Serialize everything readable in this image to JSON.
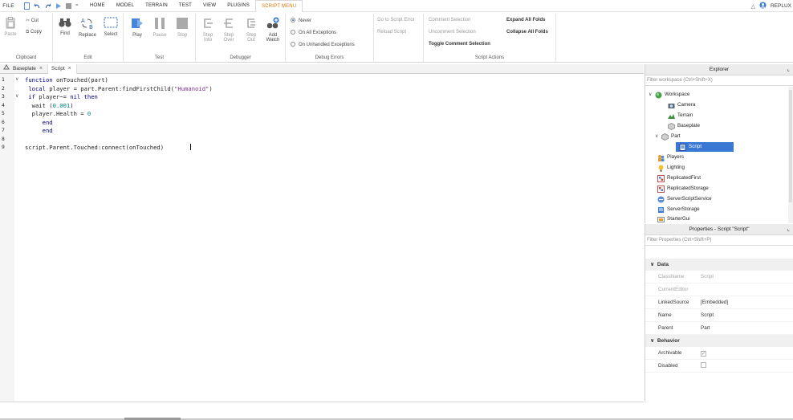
{
  "menubar": {
    "file": "FILE",
    "tabs": [
      "HOME",
      "MODEL",
      "TERRAIN",
      "TEST",
      "VIEW",
      "PLUGINS",
      "SCRIPT MENU"
    ],
    "active_tab": "SCRIPT MENU",
    "user": "REPLUX",
    "accent": "#d4730b"
  },
  "ribbon": {
    "clipboard": {
      "label": "Clipboard",
      "paste": "Paste",
      "cut": "Cut",
      "copy": "Copy"
    },
    "edit": {
      "label": "Edit",
      "find": "Find",
      "replace": "Replace",
      "select": "Select"
    },
    "test": {
      "label": "Test",
      "play": "Play",
      "pause": "Pause",
      "stop": "Stop"
    },
    "debugger": {
      "label": "Debugger",
      "step_into": "Step Into",
      "step_over": "Step Over",
      "step_out": "Step Out",
      "add_watch": "Add Watch"
    },
    "debug_errors": {
      "label": "Debug Errors",
      "never": "Never",
      "all": "On All Exceptions",
      "unhandled": "On Unhandled Exceptions",
      "selected": "Never"
    },
    "misc": {
      "goto_error": "Go to Script Error",
      "reload": "Reload Script"
    },
    "script_actions": {
      "label": "Script Actions",
      "comment": "Comment Selection",
      "uncomment": "Uncomment Selection",
      "toggle": "Toggle Comment Selection",
      "expand": "Expand All Folds",
      "collapse": "Collapse All Folds"
    }
  },
  "tabs": [
    {
      "label": "Baseplate"
    },
    {
      "label": "Script"
    }
  ],
  "editor": {
    "line_numbers": [
      "1",
      "2",
      "3",
      "4",
      "5",
      "6",
      "7",
      "8",
      "9"
    ],
    "lines": [
      "function onTouched(part)",
      " local player = part.Parent:findFirstChild(\"Humanoid\")",
      " if player~= nil then",
      "  wait (0.001)",
      "  player.Health = 0",
      "     end",
      "     end",
      "",
      "script.Parent.Touched:connect(onTouched)"
    ]
  },
  "explorer": {
    "title": "Explorer",
    "filter_placeholder": "Filter workspace (Ctrl+Shift+X)",
    "items": [
      {
        "label": "Workspace",
        "icon": "workspace-icon"
      },
      {
        "label": "Camera",
        "icon": "camera-icon"
      },
      {
        "label": "Terrain",
        "icon": "terrain-icon"
      },
      {
        "label": "Baseplate",
        "icon": "part-icon"
      },
      {
        "label": "Part",
        "icon": "part-icon"
      },
      {
        "label": "Script",
        "icon": "script-icon"
      },
      {
        "label": "Players",
        "icon": "players-icon"
      },
      {
        "label": "Lighting",
        "icon": "lighting-icon"
      },
      {
        "label": "ReplicatedFirst",
        "icon": "replicated-icon"
      },
      {
        "label": "ReplicatedStorage",
        "icon": "replicated-icon"
      },
      {
        "label": "ServerScriptService",
        "icon": "server-script-icon"
      },
      {
        "label": "ServerStorage",
        "icon": "server-storage-icon"
      },
      {
        "label": "StarterGui",
        "icon": "starter-gui-icon"
      }
    ]
  },
  "properties": {
    "title": "Properties - Script \"Script\"",
    "filter_placeholder": "Filter Properties (Ctrl+Shift+P)",
    "data_label": "Data",
    "behavior_label": "Behavior",
    "rows": {
      "classname": {
        "name": "ClassName",
        "value": "Script"
      },
      "currenteditor": {
        "name": "CurrentEditor",
        "value": ""
      },
      "linkedsource": {
        "name": "LinkedSource",
        "value": "[Embedded]"
      },
      "name": {
        "name": "Name",
        "value": "Script"
      },
      "parent": {
        "name": "Parent",
        "value": "Part"
      },
      "archivable": {
        "name": "Archivable",
        "value": "✓"
      },
      "disabled": {
        "name": "Disabled",
        "value": ""
      }
    }
  }
}
